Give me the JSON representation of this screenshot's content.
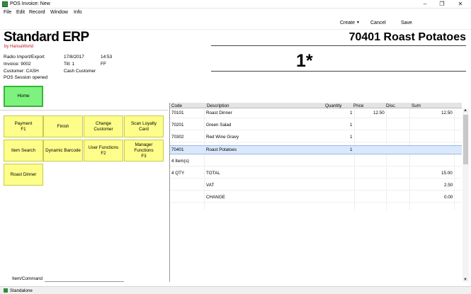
{
  "window": {
    "title": "POS Invoice: New"
  },
  "menu": [
    "File",
    "Edit",
    "Record",
    "Window",
    "Info"
  ],
  "toolbar": {
    "create": "Create",
    "cancel": "Cancel",
    "save": "Save"
  },
  "logo": {
    "main": "Standard ERP",
    "sub": "by HansaWorld"
  },
  "header": {
    "item_title": "70401 Roast Potatoes",
    "quantity": "1*"
  },
  "info": {
    "col1": [
      "Radio Import/Export",
      "Invoice: 9002",
      "Customer: CASH",
      "POS Session opened"
    ],
    "col2": [
      "17/8/2017",
      "Till: 1",
      "Cash Customer"
    ],
    "col3": [
      "14:53",
      "FF"
    ]
  },
  "home_label": "Home",
  "buttons": [
    [
      "Payment\nF1",
      "Finish",
      "Change Customer",
      "Scan Loyalty Card"
    ],
    [
      "Item Search",
      "Dynamic Barcode",
      "User Functions\nF2",
      "Manager\nFunctions\nF3"
    ],
    [
      "Roast Dinner"
    ]
  ],
  "grid": {
    "headers": [
      "Code",
      "Description",
      "Quantity",
      "Price",
      "Disc.",
      "Sum"
    ],
    "rows": [
      {
        "code": "70101",
        "desc": "Roast Dinner",
        "qty": "1",
        "price": "12.50",
        "sum": "12.50"
      },
      {
        "code": "70201",
        "desc": "Green Salad",
        "qty": "1",
        "price": "",
        "sum": ""
      },
      {
        "code": "70302",
        "desc": "Red Wine Gravy",
        "qty": "1",
        "price": "",
        "sum": ""
      },
      {
        "code": "70401",
        "desc": "Roast Potatoes",
        "qty": "1",
        "price": "",
        "sum": ""
      }
    ],
    "item_count": "4 Item(s)",
    "totals": [
      {
        "code": "4 QTY",
        "label": "TOTAL",
        "value": "15.00"
      },
      {
        "code": "",
        "label": "VAT",
        "value": "2.50"
      },
      {
        "code": "",
        "label": "CHANGE",
        "value": "0.00"
      }
    ],
    "selected_row": 3
  },
  "command": {
    "label": "Item/Command",
    "value": ""
  },
  "status": {
    "text": "Standalone"
  }
}
